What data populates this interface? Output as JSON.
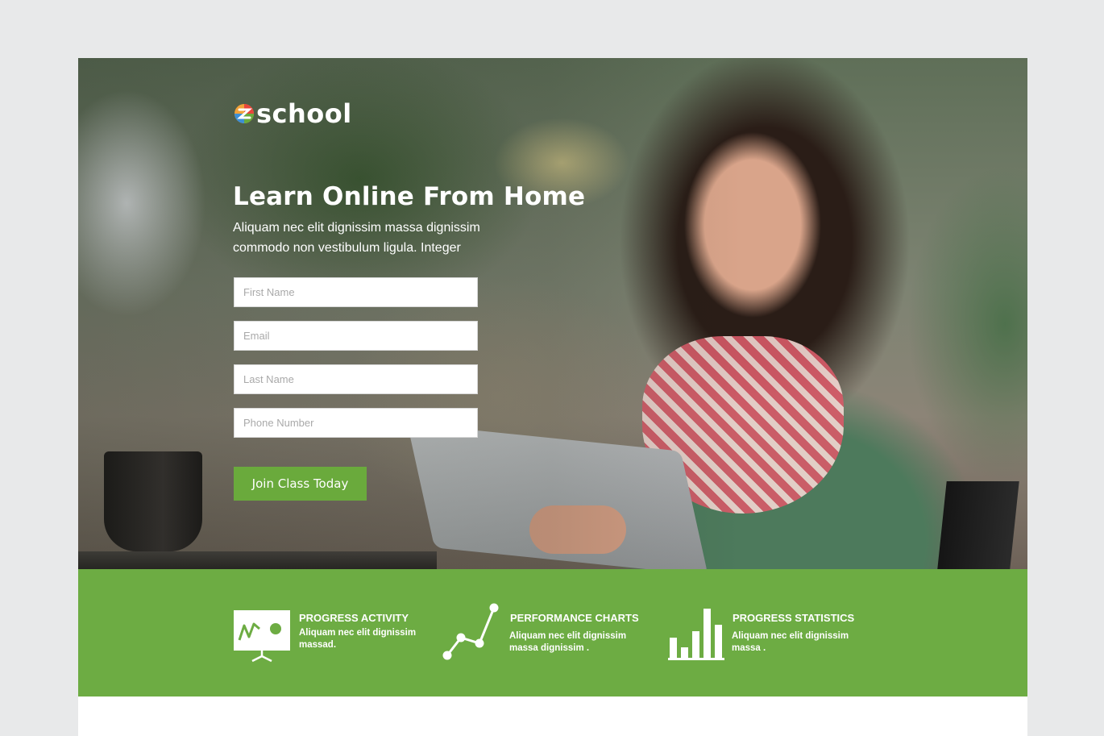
{
  "brand": {
    "logo_text": "school"
  },
  "hero": {
    "headline": "Learn Online From Home",
    "subtext": "Aliquam nec elit dignissim massa dignissim commodo non vestibulum ligula. Integer"
  },
  "form": {
    "first_name_placeholder": "First Name",
    "email_placeholder": "Email",
    "last_name_placeholder": "Last Name",
    "phone_placeholder": "Phone Number",
    "submit_label": "Join Class Today"
  },
  "features": [
    {
      "title": "PROGRESS ACTIVITY",
      "desc": "Aliquam nec elit dignissim massad.",
      "icon": "presentation-board-icon"
    },
    {
      "title": "PERFORMANCE CHARTS",
      "desc": "Aliquam nec elit dignissim massa dignissim .",
      "icon": "line-chart-icon"
    },
    {
      "title": "PROGRESS STATISTICS",
      "desc": "Aliquam nec elit dignissim massa .",
      "icon": "bar-chart-icon"
    }
  ],
  "colors": {
    "accent_green": "#6dac43",
    "button_green": "#6aaa3c",
    "page_background": "#e8e9ea"
  }
}
